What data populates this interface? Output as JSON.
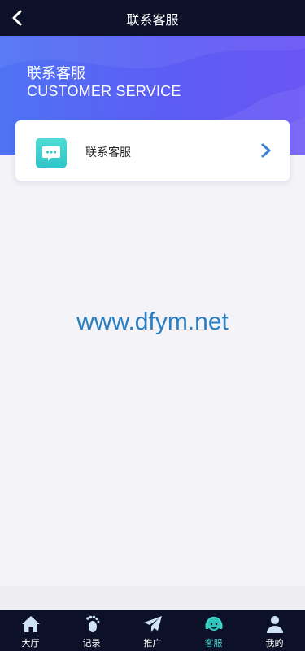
{
  "header": {
    "title": "联系客服"
  },
  "banner": {
    "title_cn": "联系客服",
    "title_en": "CUSTOMER SERVICE"
  },
  "card": {
    "label": "联系客服"
  },
  "watermark": {
    "text": "www.dfym.net"
  },
  "tabbar": {
    "items": [
      {
        "label": "大厅",
        "icon": "home-icon"
      },
      {
        "label": "记录",
        "icon": "footprint-icon"
      },
      {
        "label": "推广",
        "icon": "paper-plane-icon"
      },
      {
        "label": "客服",
        "icon": "headset-icon",
        "active": true
      },
      {
        "label": "我的",
        "icon": "user-icon"
      }
    ]
  },
  "colors": {
    "header_bg": "#0c1028",
    "banner_start": "#4f73f3",
    "banner_end": "#6a55f5",
    "accent_teal": "#3fd4c8",
    "arrow_blue": "#3d7fd6",
    "watermark": "#2a7ec2"
  }
}
